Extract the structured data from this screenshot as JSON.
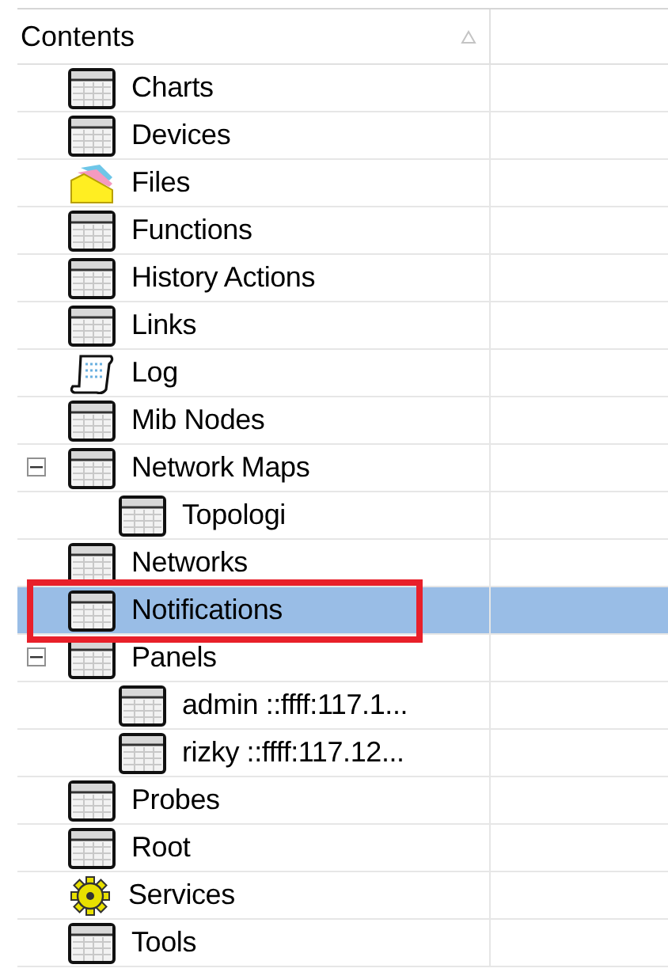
{
  "header": {
    "columns": [
      "Contents"
    ],
    "sorted": true
  },
  "tree": [
    {
      "label": "Charts",
      "kind": "table",
      "selected": false
    },
    {
      "label": "Devices",
      "kind": "table",
      "selected": false
    },
    {
      "label": "Files",
      "kind": "files",
      "selected": false
    },
    {
      "label": "Functions",
      "kind": "table",
      "selected": false
    },
    {
      "label": "History Actions",
      "kind": "table",
      "selected": false
    },
    {
      "label": "Links",
      "kind": "table",
      "selected": false
    },
    {
      "label": "Log",
      "kind": "log",
      "selected": false
    },
    {
      "label": "Mib Nodes",
      "kind": "table",
      "selected": false
    },
    {
      "label": "Network Maps",
      "kind": "table",
      "selected": false,
      "expanded": true,
      "children": [
        {
          "label": "Topologi",
          "kind": "table",
          "selected": false
        }
      ]
    },
    {
      "label": "Networks",
      "kind": "table",
      "selected": false
    },
    {
      "label": "Notifications",
      "kind": "table",
      "selected": true
    },
    {
      "label": "Panels",
      "kind": "table",
      "selected": false,
      "expanded": true,
      "children": [
        {
          "label": "admin ::ffff:117.1...",
          "kind": "table",
          "selected": false
        },
        {
          "label": "rizky ::ffff:117.12...",
          "kind": "table",
          "selected": false
        }
      ]
    },
    {
      "label": "Probes",
      "kind": "table",
      "selected": false
    },
    {
      "label": "Root",
      "kind": "table",
      "selected": false
    },
    {
      "label": "Services",
      "kind": "gear",
      "selected": false
    },
    {
      "label": "Tools",
      "kind": "table",
      "selected": false
    }
  ]
}
